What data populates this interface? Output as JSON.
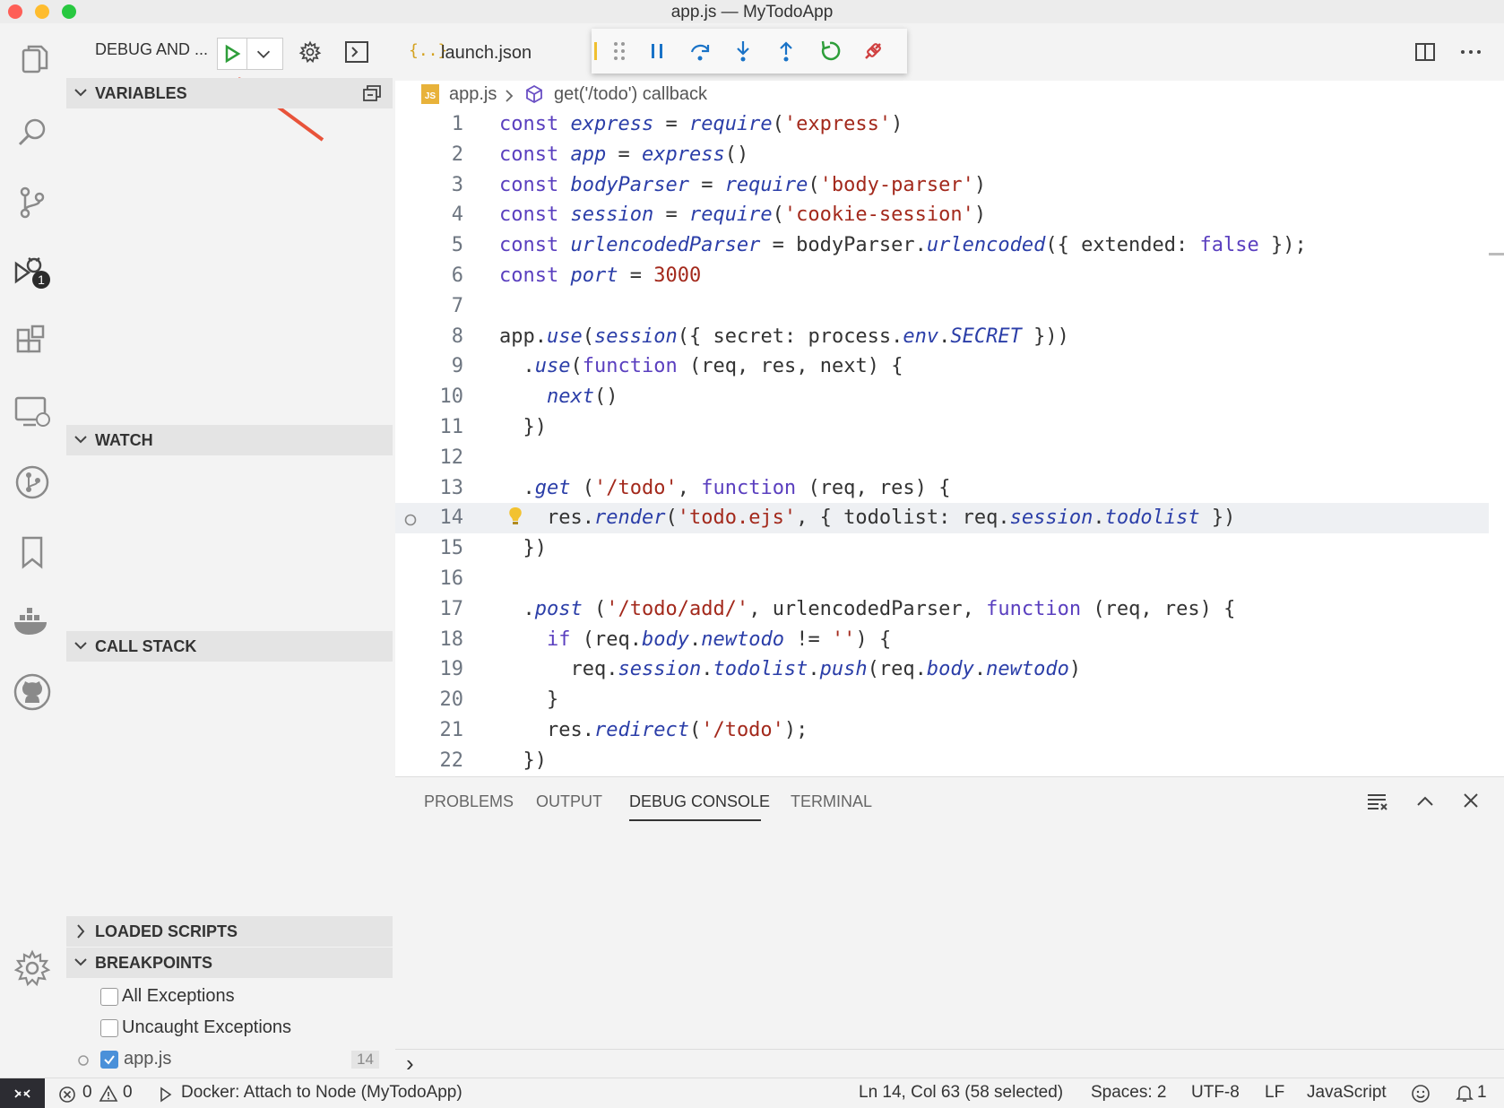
{
  "window": {
    "title": "app.js — MyTodoApp"
  },
  "debug": {
    "config_label": "DEBUG AND ...",
    "launch_tab": "launch.json"
  },
  "sidebar": {
    "variables": "VARIABLES",
    "watch": "WATCH",
    "call_stack": "CALL STACK",
    "loaded_scripts": "LOADED SCRIPTS",
    "breakpoints": "BREAKPOINTS",
    "breakpoint_items": [
      {
        "label": "All Exceptions",
        "checked": false
      },
      {
        "label": "Uncaught Exceptions",
        "checked": false
      },
      {
        "label": "app.js",
        "checked": true,
        "line": "14"
      }
    ]
  },
  "breadcrumbs": {
    "file": "app.js",
    "symbol": "get('/todo') callback"
  },
  "code_lines": [
    "const express = require('express')",
    "const app = express()",
    "const bodyParser = require('body-parser')",
    "const session = require('cookie-session')",
    "const urlencodedParser = bodyParser.urlencoded({ extended: false });",
    "const port = 3000",
    "",
    "app.use(session({ secret: process.env.SECRET }))",
    "  .use(function (req, res, next) {",
    "    next()",
    "  })",
    "",
    "  .get ('/todo', function (req, res) {",
    "    res.render('todo.ejs', { todolist: req.session.todolist })",
    "  })",
    "",
    "  .post ('/todo/add/', urlencodedParser, function (req, res) {",
    "    if (req.body.newtodo != '') {",
    "      req.session.todolist.push(req.body.newtodo)",
    "    }",
    "    res.redirect('/todo');",
    "  })"
  ],
  "line_numbers": [
    "1",
    "2",
    "3",
    "4",
    "5",
    "6",
    "7",
    "8",
    "9",
    "10",
    "11",
    "12",
    "13",
    "14",
    "15",
    "16",
    "17",
    "18",
    "19",
    "20",
    "21",
    "22"
  ],
  "panel": {
    "tabs": [
      "PROBLEMS",
      "OUTPUT",
      "DEBUG CONSOLE",
      "TERMINAL"
    ],
    "active_tab": "DEBUG CONSOLE",
    "prompt": "›"
  },
  "statusbar": {
    "errors": "0",
    "warnings": "0",
    "attach": "Docker: Attach to Node (MyTodoApp)",
    "position": "Ln 14, Col 63 (58 selected)",
    "spaces": "Spaces: 2",
    "encoding": "UTF-8",
    "eol": "LF",
    "language": "JavaScript",
    "notifications": "1"
  },
  "badges": {
    "debug_count": "1"
  },
  "colors": {
    "accent_green": "#2e9e3a",
    "debug_blue": "#1a73c7",
    "arrow_red": "#e8533a"
  },
  "icons": [
    "files-icon",
    "search-icon",
    "source-control-icon",
    "run-debug-icon",
    "extensions-icon",
    "remote-explorer-icon",
    "git-graph-icon",
    "bookmarks-icon",
    "docker-icon",
    "github-icon",
    "settings-gear-icon"
  ]
}
